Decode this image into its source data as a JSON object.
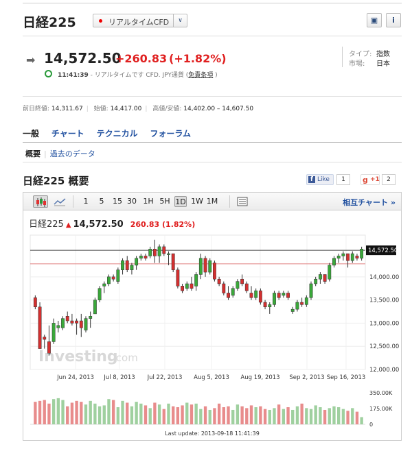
{
  "header": {
    "title": "日経225",
    "selector": "リアルタイムCFD",
    "selector_arrow": "∨",
    "portfolio_icon": "▣",
    "info_icon": "i"
  },
  "quote": {
    "price": "14,572.50",
    "change": "+260.83",
    "change_pct": "(+1.82%)",
    "time": "11:41:39",
    "time_note": "- リアルタイムです CFD. JPY通貨 (",
    "disclaimer": "免責条項",
    "time_end": ")"
  },
  "meta": {
    "type_label": "タイプ:",
    "type_value": "指数",
    "market_label": "市場:",
    "market_value": "日本"
  },
  "stats": {
    "prev_label": "前日終値:",
    "prev_value": "14,311.67",
    "open_label": "始値:",
    "open_value": "14,417.00",
    "range_label": "高値/安値:",
    "range_value": "14,402.00 – 14,607.50"
  },
  "tabs": [
    "一般",
    "チャート",
    "テクニカル",
    "フォーラム"
  ],
  "subtabs": {
    "active": "概要",
    "link": "過去のデータ"
  },
  "section": {
    "title": "日経225 概要",
    "like": "Like",
    "like_count": "1",
    "gplus": "+1",
    "gplus_count": "2"
  },
  "toolbar": {
    "periods": [
      "1",
      "5",
      "15",
      "30",
      "1H",
      "5H",
      "1D",
      "1W",
      "1M"
    ],
    "active_period": "1D",
    "mutual": "相互チャート »"
  },
  "chart_title": {
    "name": "日経225",
    "price": "14,572.50",
    "change": "260.83 (1.82%)"
  },
  "chart_data": {
    "type": "candlestick",
    "price_label": "14,572.50",
    "y_ticks": [
      12000,
      12500,
      13000,
      13500,
      14000
    ],
    "y_tick_labels": [
      "12,000.00",
      "12,500.00",
      "13,000.00",
      "13,500.00",
      "14,000.00"
    ],
    "ylim": [
      12000,
      14900
    ],
    "x_labels": [
      "Jun 24, 2013",
      "Jul 8, 2013",
      "Jul 22, 2013",
      "Aug 5, 2013",
      "Aug 19, 2013",
      "Sep 2, 2013",
      "Sep 16, 2013"
    ],
    "vol_ticks": [
      "350.00K",
      "175.00K",
      "0"
    ],
    "vol_max": 350,
    "watermark": "Investing",
    "watermark_suffix": ".com",
    "last_update": "Last update: 2013-09-18 11:41:39",
    "reference_line": 14280,
    "last_price": 14572.5,
    "candles": [
      [
        13550,
        13600,
        13300,
        13350
      ],
      [
        13350,
        13450,
        12450,
        12450
      ],
      [
        12700,
        12750,
        12450,
        12650
      ],
      [
        12600,
        12950,
        12300,
        12350
      ],
      [
        12600,
        13100,
        12550,
        13000
      ],
      [
        12900,
        13050,
        12800,
        12950
      ],
      [
        12900,
        13150,
        12850,
        13100
      ],
      [
        13150,
        13250,
        13000,
        13050
      ],
      [
        13050,
        13200,
        12950,
        13000
      ],
      [
        13050,
        13100,
        12750,
        13000
      ],
      [
        13050,
        13200,
        12700,
        12900
      ],
      [
        12850,
        13150,
        12800,
        13100
      ],
      [
        13100,
        13250,
        12900,
        13150
      ],
      [
        13200,
        13550,
        13200,
        13500
      ],
      [
        13500,
        13800,
        13450,
        13750
      ],
      [
        13800,
        13900,
        13650,
        13850
      ],
      [
        13850,
        14050,
        13800,
        14000
      ],
      [
        14000,
        14050,
        13900,
        13950
      ],
      [
        13900,
        14200,
        13850,
        14150
      ],
      [
        14150,
        14400,
        14050,
        14350
      ],
      [
        14350,
        14450,
        14100,
        14150
      ],
      [
        14150,
        14300,
        14050,
        14250
      ],
      [
        14250,
        14450,
        14150,
        14400
      ],
      [
        14400,
        14500,
        14350,
        14450
      ],
      [
        14450,
        14500,
        14350,
        14400
      ],
      [
        14450,
        14650,
        14400,
        14600
      ],
      [
        14600,
        14800,
        14300,
        14450
      ],
      [
        14450,
        14700,
        14300,
        14650
      ],
      [
        14650,
        14700,
        14450,
        14500
      ],
      [
        14500,
        14550,
        14250,
        14500
      ],
      [
        14500,
        14500,
        14100,
        14150
      ],
      [
        14150,
        14200,
        13750,
        13800
      ],
      [
        13800,
        13850,
        13650,
        13700
      ],
      [
        13750,
        13900,
        13700,
        13850
      ],
      [
        13850,
        14000,
        13700,
        13750
      ],
      [
        13800,
        14100,
        13700,
        14050
      ],
      [
        14050,
        14500,
        13950,
        14400
      ],
      [
        14400,
        14450,
        14000,
        14100
      ],
      [
        14100,
        14400,
        14050,
        14350
      ],
      [
        14300,
        14350,
        13900,
        13950
      ],
      [
        13950,
        14000,
        13800,
        13850
      ],
      [
        13850,
        13900,
        13600,
        13650
      ],
      [
        13650,
        13800,
        13500,
        13550
      ],
      [
        13600,
        13800,
        13550,
        13750
      ],
      [
        13750,
        13950,
        13700,
        13900
      ],
      [
        13950,
        14050,
        13800,
        13850
      ],
      [
        13850,
        13900,
        13650,
        13700
      ],
      [
        13650,
        13800,
        13500,
        13550
      ],
      [
        13550,
        13750,
        13500,
        13700
      ],
      [
        13700,
        13750,
        13400,
        13450
      ],
      [
        13450,
        13500,
        13300,
        13350
      ],
      [
        13350,
        13450,
        13200,
        13400
      ],
      [
        13400,
        13700,
        13350,
        13650
      ],
      [
        13650,
        13700,
        13500,
        13550
      ],
      [
        13600,
        13700,
        13550,
        13650
      ],
      [
        13650,
        13700,
        13500,
        13550
      ],
      [
        13250,
        13350,
        13200,
        13300
      ],
      [
        13300,
        13500,
        13250,
        13450
      ],
      [
        13450,
        13550,
        13350,
        13400
      ],
      [
        13400,
        13600,
        13350,
        13550
      ],
      [
        13550,
        13900,
        13500,
        13850
      ],
      [
        13850,
        14000,
        13800,
        13950
      ],
      [
        13950,
        14100,
        13850,
        14050
      ],
      [
        14050,
        14050,
        13850,
        13900
      ],
      [
        13950,
        14300,
        13900,
        14250
      ],
      [
        14250,
        14450,
        14200,
        14400
      ],
      [
        14400,
        14500,
        14300,
        14450
      ],
      [
        14450,
        14550,
        14350,
        14500
      ],
      [
        14500,
        14500,
        14200,
        14350
      ],
      [
        14350,
        14550,
        14300,
        14500
      ],
      [
        14450,
        14500,
        14350,
        14400
      ],
      [
        14400,
        14650,
        14350,
        14600
      ]
    ],
    "volumes": [
      250,
      260,
      270,
      230,
      280,
      290,
      270,
      200,
      240,
      260,
      250,
      220,
      260,
      230,
      200,
      210,
      280,
      270,
      190,
      260,
      240,
      200,
      250,
      230,
      210,
      180,
      240,
      220,
      170,
      230,
      200,
      190,
      210,
      240,
      220,
      230,
      170,
      200,
      160,
      180,
      230,
      190,
      200,
      160,
      220,
      200,
      180,
      210,
      190,
      200,
      170,
      160,
      180,
      220,
      170,
      190,
      160,
      200,
      230,
      180,
      170,
      210,
      190,
      160,
      180,
      200,
      190,
      170,
      150,
      180,
      140,
      80
    ]
  }
}
